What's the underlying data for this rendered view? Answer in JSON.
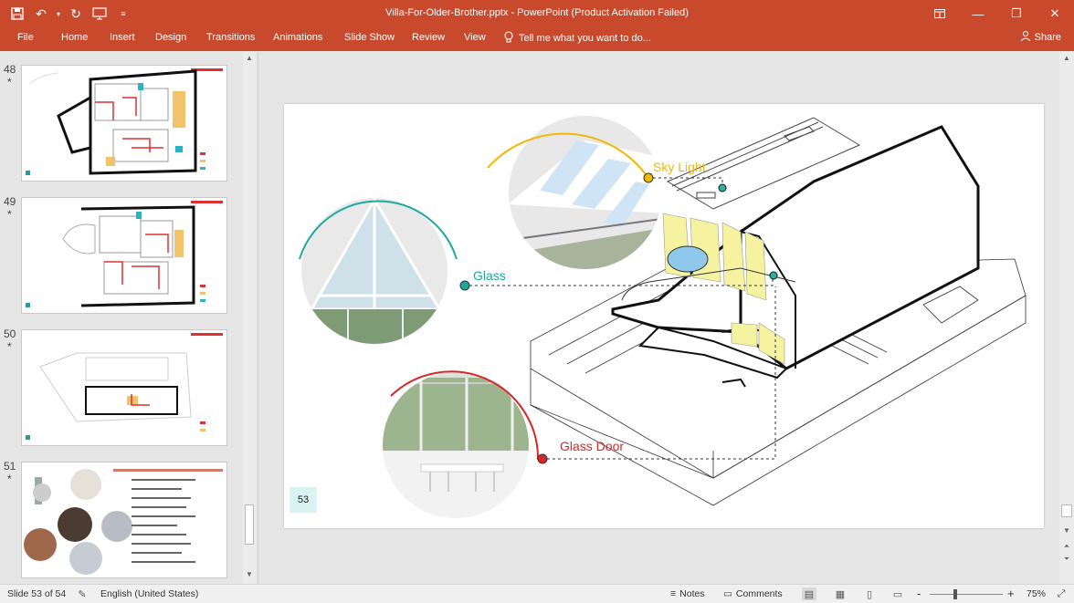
{
  "titlebar": {
    "title": "Villa-For-Older-Brother.pptx - PowerPoint (Product Activation Failed)",
    "qat": {
      "save_icon": "save-icon",
      "undo_icon": "undo-icon",
      "redo_icon": "redo-icon",
      "start_icon": "start-from-beginning-icon",
      "customize_icon": "customize-qat-icon"
    },
    "window_icons": [
      "ribbon-display-options-icon",
      "minimize-icon",
      "restore-icon",
      "close-icon"
    ]
  },
  "ribbon": {
    "tabs": [
      "File",
      "Home",
      "Insert",
      "Design",
      "Transitions",
      "Animations",
      "Slide Show",
      "Review",
      "View"
    ],
    "tell_me": "Tell me what you want to do...",
    "share": "Share"
  },
  "thumbnails": [
    {
      "number": "48",
      "star": "*"
    },
    {
      "number": "49",
      "star": "*"
    },
    {
      "number": "50",
      "star": "*"
    },
    {
      "number": "51",
      "star": "*"
    }
  ],
  "slide": {
    "number": "53",
    "labels": {
      "sky_light": "Sky Light",
      "glass": "Glass",
      "glass_door": "Glass Door"
    },
    "colors": {
      "sky_light": "#f2b705",
      "glass": "#1aa99d",
      "glass_door": "#d62828"
    }
  },
  "statusbar": {
    "slide_info": "Slide 53 of 54",
    "language": "English (United States)",
    "notes": "Notes",
    "comments": "Comments",
    "zoom_minus": "-",
    "zoom_plus": "+",
    "zoom": "75%"
  }
}
